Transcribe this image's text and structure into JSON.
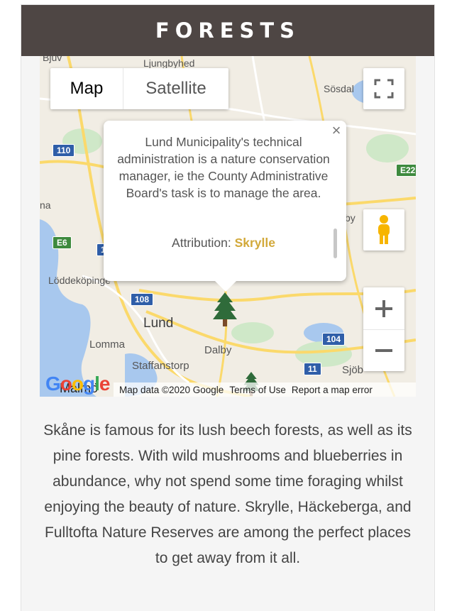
{
  "header": {
    "title": "FORESTS"
  },
  "map": {
    "type_controls": {
      "map_label": "Map",
      "satellite_label": "Satellite"
    },
    "places": {
      "ljungbyhed": "Ljungbyhed",
      "sosdala": "Sösdal",
      "landskrona": "na",
      "loddekopinge": "Löddeköpinge",
      "lund": "Lund",
      "lomma": "Lomma",
      "dalby": "Dalby",
      "staffanstorp": "Staffanstorp",
      "sjobo": "Sjöb",
      "eslov": "by",
      "bjuv": "Bjuv",
      "malmo": "Malmö"
    },
    "shields": {
      "r110": "110",
      "e6": "E6",
      "r108": "108",
      "r104": "104",
      "r11": "11",
      "e22": "E22",
      "r1": "1"
    },
    "popup": {
      "text": "Lund Municipality's technical administration is a nature conservation manager, ie the County Administrative Board's task is to manage the area.",
      "attribution_label": "Attribution:",
      "attribution_name": "Skrylle",
      "close_icon": "close-icon"
    },
    "logo": "Google",
    "footer": {
      "map_data": "Map data ©2020 Google",
      "terms": "Terms of Use",
      "report": "Report a map error"
    },
    "colors": {
      "tree": "#2f6b3a",
      "water": "#a8c8ee",
      "road": "#fbd96b",
      "park": "#cfe8c8"
    }
  },
  "description": "Skåne is famous for its lush beech forests, as well as its pine forests. With wild mushrooms and blueberries in abundance, why not spend some time foraging whilst enjoying the beauty of nature. Skrylle, Häckeberga, and Fulltofta Nature Reserves are among the perfect places to get away from it all."
}
